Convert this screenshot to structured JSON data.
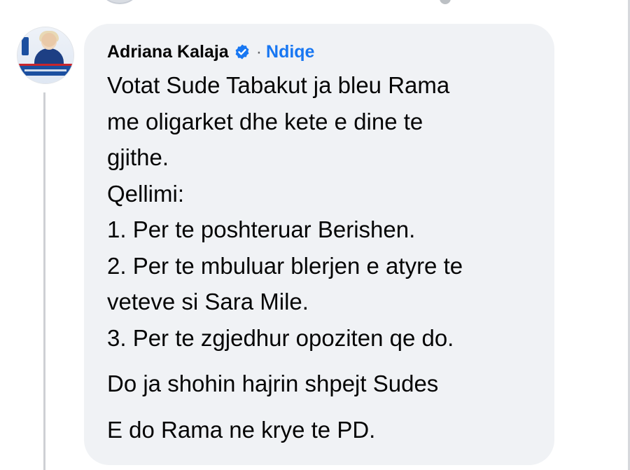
{
  "comment": {
    "author": "Adriana Kalaja",
    "separator": "·",
    "follow_label": "Ndiqe",
    "lines": [
      "Votat Sude Tabakut ja bleu Rama",
      "me oligarket dhe kete e dine te",
      "gjithe.",
      "Qellimi:",
      "1. Per te poshteruar Berishen.",
      "2. Per te mbuluar blerjen e atyre te",
      "veteve si Sara Mile.",
      "3. Per te zgjedhur opoziten qe do."
    ],
    "paragraph_2": "Do ja shohin hajrin shpejt Sudes",
    "paragraph_3": "E do Rama ne krye te PD."
  },
  "icons": {
    "verified": "verified-badge-icon",
    "avatar": "profile-avatar"
  },
  "colors": {
    "bubble_bg": "#f0f2f5",
    "link_blue": "#1877f2",
    "text": "#050505",
    "muted": "#65676b"
  }
}
